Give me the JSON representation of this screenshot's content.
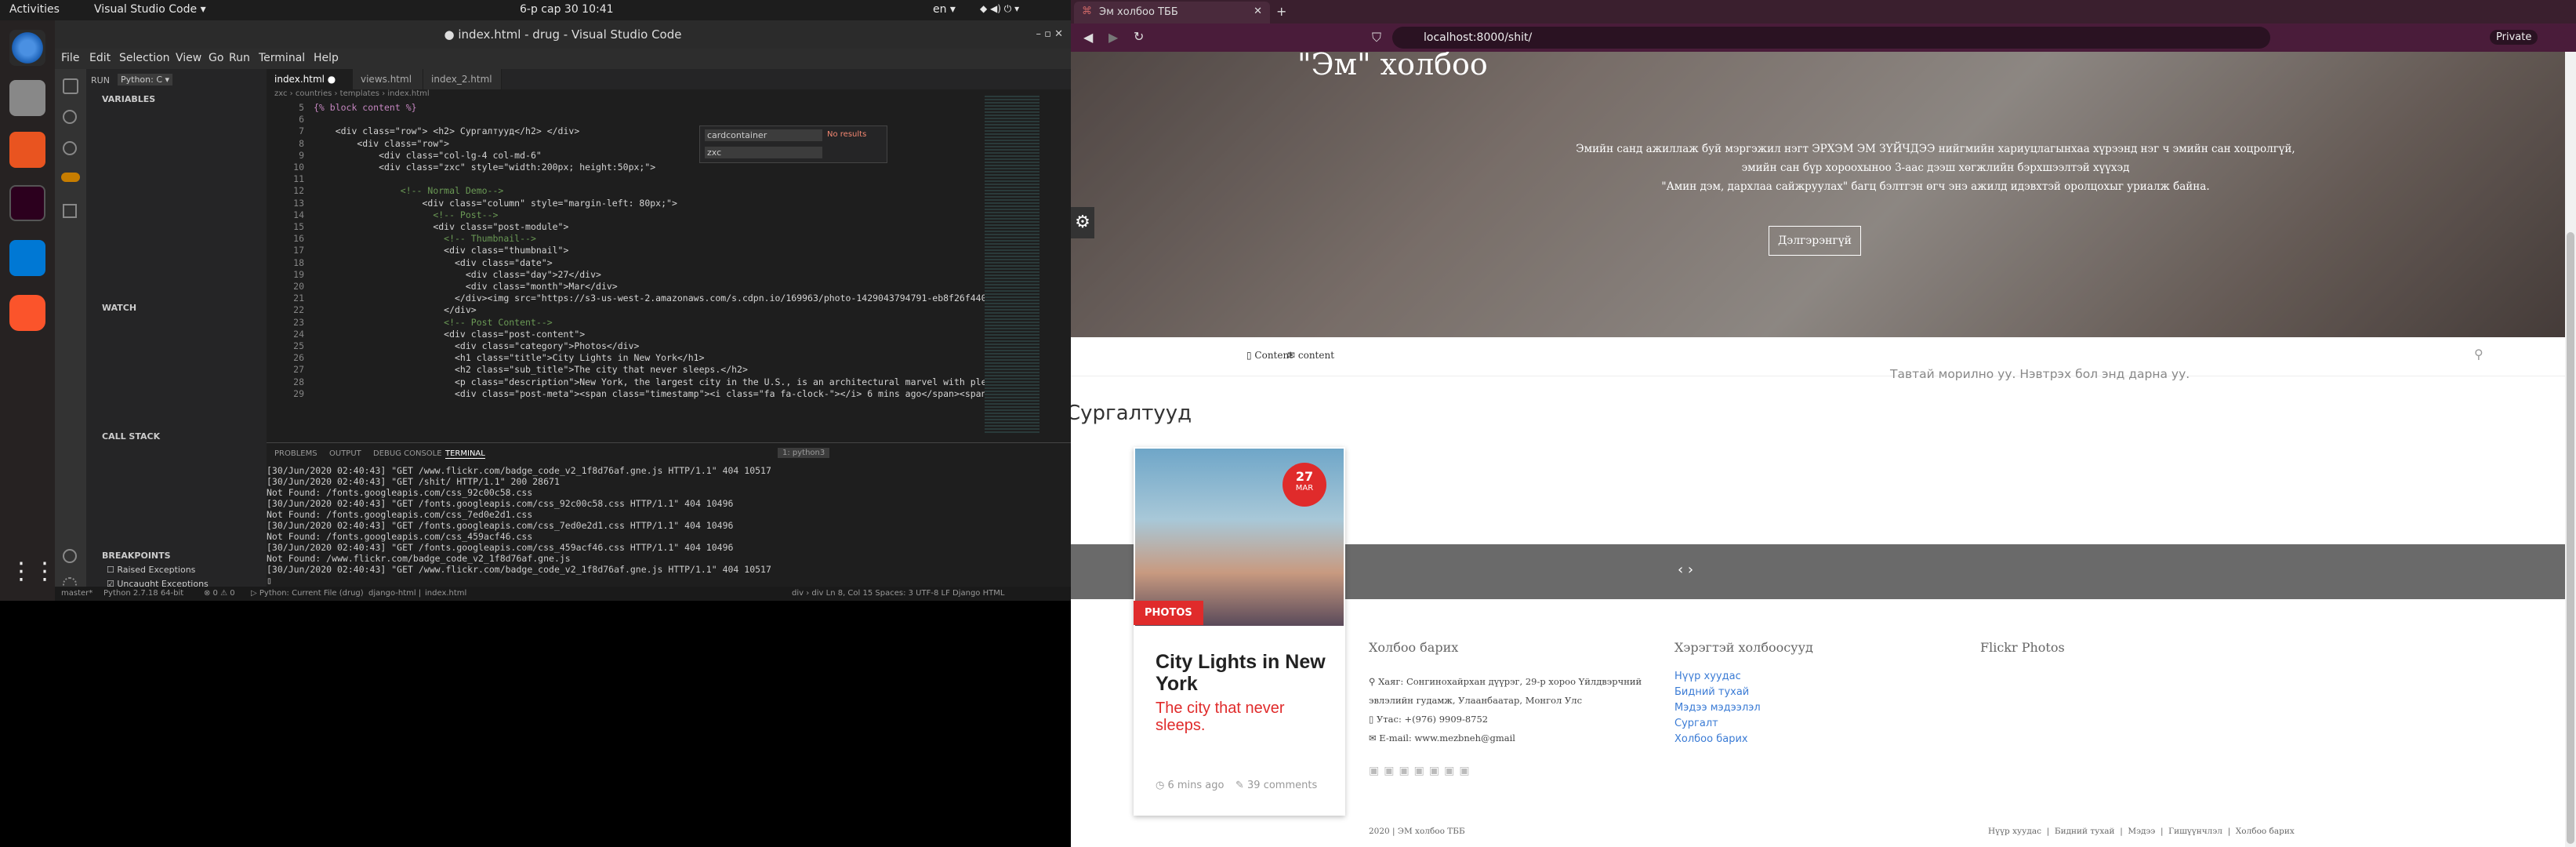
{
  "topbar": {
    "activities": "Activities",
    "app": "Visual Studio Code ▾",
    "clock": "6-р сар 30  10:41",
    "lang": "en ▾"
  },
  "dock": {
    "icons": [
      "chromium-icon",
      "files-icon",
      "software-icon",
      "terminal-icon",
      "vscode-icon",
      "brave-icon",
      "apps-grid-icon"
    ]
  },
  "vscode": {
    "title": "● index.html - drug - Visual Studio Code",
    "menu": [
      "File",
      "Edit",
      "Selection",
      "View",
      "Go",
      "Run",
      "Terminal",
      "Help"
    ],
    "run_label": "RUN",
    "run_config": "Python: C ▾",
    "side": {
      "variables": "VARIABLES",
      "watch": "WATCH",
      "callstack": "CALL STACK",
      "breakpoints": "BREAKPOINTS",
      "bp1": "Raised Exceptions",
      "bp2": "Uncaught Exceptions"
    },
    "tabs": [
      "index.html ●",
      "views.html",
      "index_2.html"
    ],
    "breadcrumb": "zxc › countries › templates › index.html",
    "find": {
      "value": "cardcontainer",
      "result": "No results",
      "replace": "zxc"
    },
    "lines": [
      {
        "n": "5",
        "t": "{% block content %}"
      },
      {
        "n": "6",
        "t": ""
      },
      {
        "n": "7",
        "t": "    <div class=\"row\"> <h2> Сургалтууд</h2> </div>"
      },
      {
        "n": "8",
        "t": "        <div class=\"row\">"
      },
      {
        "n": "9",
        "t": "            <div class=\"col-lg-4 col-md-6\""
      },
      {
        "n": "10",
        "t": "            <div class=\"zxc\" style=\"width:200px; height:50px;\">"
      },
      {
        "n": "11",
        "t": ""
      },
      {
        "n": "12",
        "t": "                <!-- Normal Demo-->"
      },
      {
        "n": "13",
        "t": "                    <div class=\"column\" style=\"margin-left: 80px;\">"
      },
      {
        "n": "14",
        "t": "                      <!-- Post-->"
      },
      {
        "n": "15",
        "t": "                      <div class=\"post-module\">"
      },
      {
        "n": "16",
        "t": "                        <!-- Thumbnail-->"
      },
      {
        "n": "17",
        "t": "                        <div class=\"thumbnail\">"
      },
      {
        "n": "18",
        "t": "                          <div class=\"date\">"
      },
      {
        "n": "19",
        "t": "                            <div class=\"day\">27</div>"
      },
      {
        "n": "20",
        "t": "                            <div class=\"month\">Mar</div>"
      },
      {
        "n": "21",
        "t": "                          </div><img src=\"https://s3-us-west-2.amazonaws.com/s.cdpn.io/169963/photo-1429043794791-eb8f26f44081."
      },
      {
        "n": "22",
        "t": "                        </div>"
      },
      {
        "n": "23",
        "t": "                        <!-- Post Content-->"
      },
      {
        "n": "24",
        "t": "                        <div class=\"post-content\">"
      },
      {
        "n": "25",
        "t": "                          <div class=\"category\">Photos</div>"
      },
      {
        "n": "26",
        "t": "                          <h1 class=\"title\">City Lights in New York</h1>"
      },
      {
        "n": "27",
        "t": "                          <h2 class=\"sub_title\">The city that never sleeps.</h2>"
      },
      {
        "n": "28",
        "t": "                          <p class=\"description\">New York, the largest city in the U.S., is an architectural marvel with plenty"
      },
      {
        "n": "29",
        "t": "                          <div class=\"post-meta\"><span class=\"timestamp\"><i class=\"fa fa-clock-\"></i> 6 mins ago</span><span cl"
      }
    ],
    "panel_tabs": [
      "PROBLEMS",
      "OUTPUT",
      "DEBUG CONSOLE",
      "TERMINAL"
    ],
    "terminal_select": "1: python3",
    "terminal": [
      "[30/Jun/2020 02:40:43] \"GET /www.flickr.com/badge_code_v2_1f8d76af.gne.js HTTP/1.1\" 404 10517",
      "[30/Jun/2020 02:40:43] \"GET /shit/ HTTP/1.1\" 200 28671",
      "Not Found: /fonts.googleapis.com/css_92c00c58.css",
      "[30/Jun/2020 02:40:43] \"GET /fonts.googleapis.com/css_92c00c58.css HTTP/1.1\" 404 10496",
      "Not Found: /fonts.googleapis.com/css_7ed0e2d1.css",
      "[30/Jun/2020 02:40:43] \"GET /fonts.googleapis.com/css_7ed0e2d1.css HTTP/1.1\" 404 10496",
      "Not Found: /fonts.googleapis.com/css_459acf46.css",
      "[30/Jun/2020 02:40:43] \"GET /fonts.googleapis.com/css_459acf46.css HTTP/1.1\" 404 10496",
      "Not Found: /www.flickr.com/badge_code_v2_1f8d76af.gne.js",
      "[30/Jun/2020 02:40:43] \"GET /www.flickr.com/badge_code_v2_1f8d76af.gne.js HTTP/1.1\" 404 10517",
      "▯"
    ],
    "status": {
      "branch": "master*",
      "python": "Python 2.7.18 64-bit",
      "errors": "⊗ 0 ⚠ 0",
      "run": "▷ Python: Current File (drug)",
      "django": "django-html |",
      "file": "index.html",
      "pos": "div › div   Ln 8, Col 15   Spaces: 3   UTF-8   LF   Django HTML"
    }
  },
  "browser": {
    "tab_title": "Эм холбоо ТББ",
    "new_tab": "+",
    "url": "localhost:8000/shit/",
    "private": "Private",
    "hero": {
      "title": "\"Эм\" холбоо",
      "line1": "Эмийн санд ажиллаж буй мэргэжил нэгт ЭРХЭМ ЭМ ЗҮЙЧДЭЭ нийгмийн хариуцлагынхаа хүрээнд нэг ч эмийн сан хоцролгүй,",
      "line2": "эмийн сан бүр хороохыноо 3-аас дээш хөгжлийн бэрхшээлтэй хүүхэд",
      "line3": "\"Амин дэм, дархлаа сайжруулах\" багц бэлтгэн өгч энэ ажилд идэвхтэй оролцохыг уриалж байна.",
      "button": "Дэлгэрэнгүй"
    },
    "nav": {
      "content1": "Content",
      "content2": "content"
    },
    "welcome": "Тавтай морилно уу. Нэвтрэх бол энд дарна уу.",
    "section_title": "Сургалтууд",
    "card": {
      "day": "27",
      "month": "MAR",
      "category": "PHOTOS",
      "title": "City Lights in New York",
      "subtitle": "The city that never sleeps.",
      "time": "6 mins ago",
      "comments": "39 comments"
    },
    "footer": {
      "col1": {
        "title": "Холбоо барих",
        "address": "Хаяг: Сонгинохайрхан дүүрэг, 29-р хороо Үйлдвэрчний эвлэлийн гудамж, Улаанбаатар, Монгол Улс",
        "phone": "Утас: +(976) 9909-8752",
        "email": "E-mail: www.mezbneh@gmail"
      },
      "col2": {
        "title": "Хэрэгтэй холбоосууд",
        "links": [
          "Нүүр хуудас",
          "Бидний тухай",
          "Мэдээ мэдээлэл",
          "Сургалт",
          "Холбоо барих"
        ]
      },
      "col3": {
        "title": "Flickr Photos"
      },
      "copyright": "2020 | ЭМ холбоо ТББ",
      "bottom_links": "Нүүр хуудас  |  Бидний тухай  |  Мэдээ  |  Гишүүнчлэл  |  Холбоо барих"
    }
  }
}
